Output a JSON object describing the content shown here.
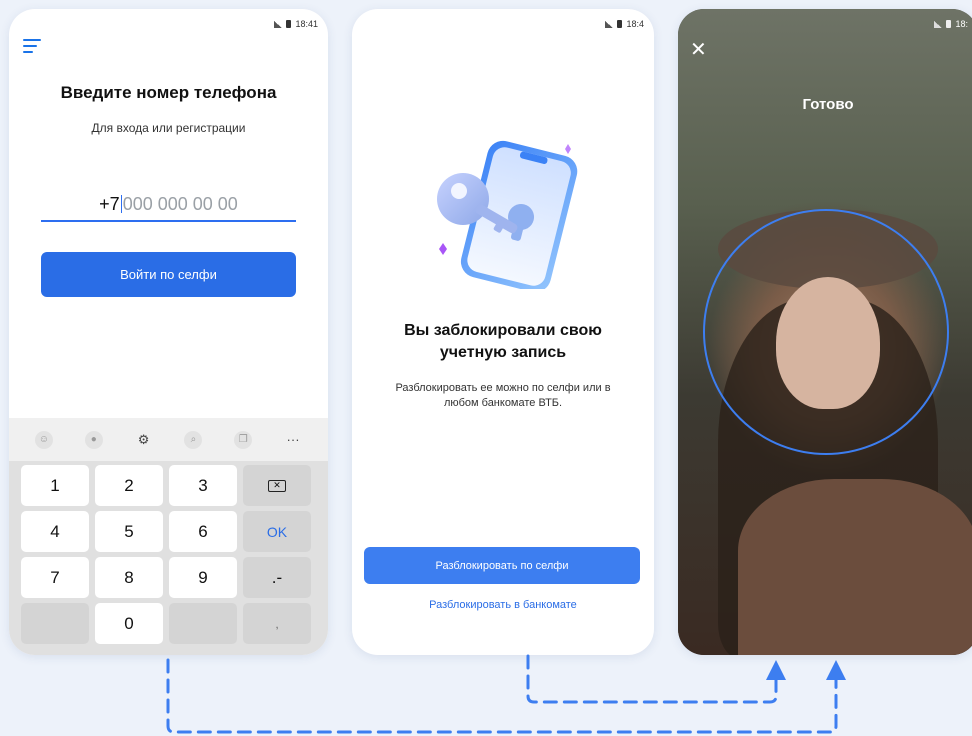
{
  "status_time": "18:41",
  "screen1": {
    "title": "Введите номер телефона",
    "subtitle": "Для входа или регистрации",
    "phone_prefix": "+7",
    "phone_placeholder": "000 000 00 00",
    "selfie_button": "Войти по селфи",
    "keys": [
      "1",
      "2",
      "3",
      "4",
      "5",
      "6",
      "OK",
      "7",
      "8",
      "9",
      ".-",
      "0",
      ","
    ],
    "toolbar_more": "···"
  },
  "screen2": {
    "status_time": "18:4",
    "title": "Вы заблокировали свою учетную запись",
    "text": "Разблокировать ее можно по селфи или в любом банкомате ВТБ.",
    "unlock_selfie_button": "Разблокировать по селфи",
    "unlock_atm_link": "Разблокировать в банкомате"
  },
  "screen3": {
    "status_time": "18:",
    "title": "Готово",
    "close_symbol": "✕"
  },
  "colors": {
    "accent": "#2a6de6",
    "background": "#edf2fa",
    "arrow": "#3d7ef0"
  }
}
